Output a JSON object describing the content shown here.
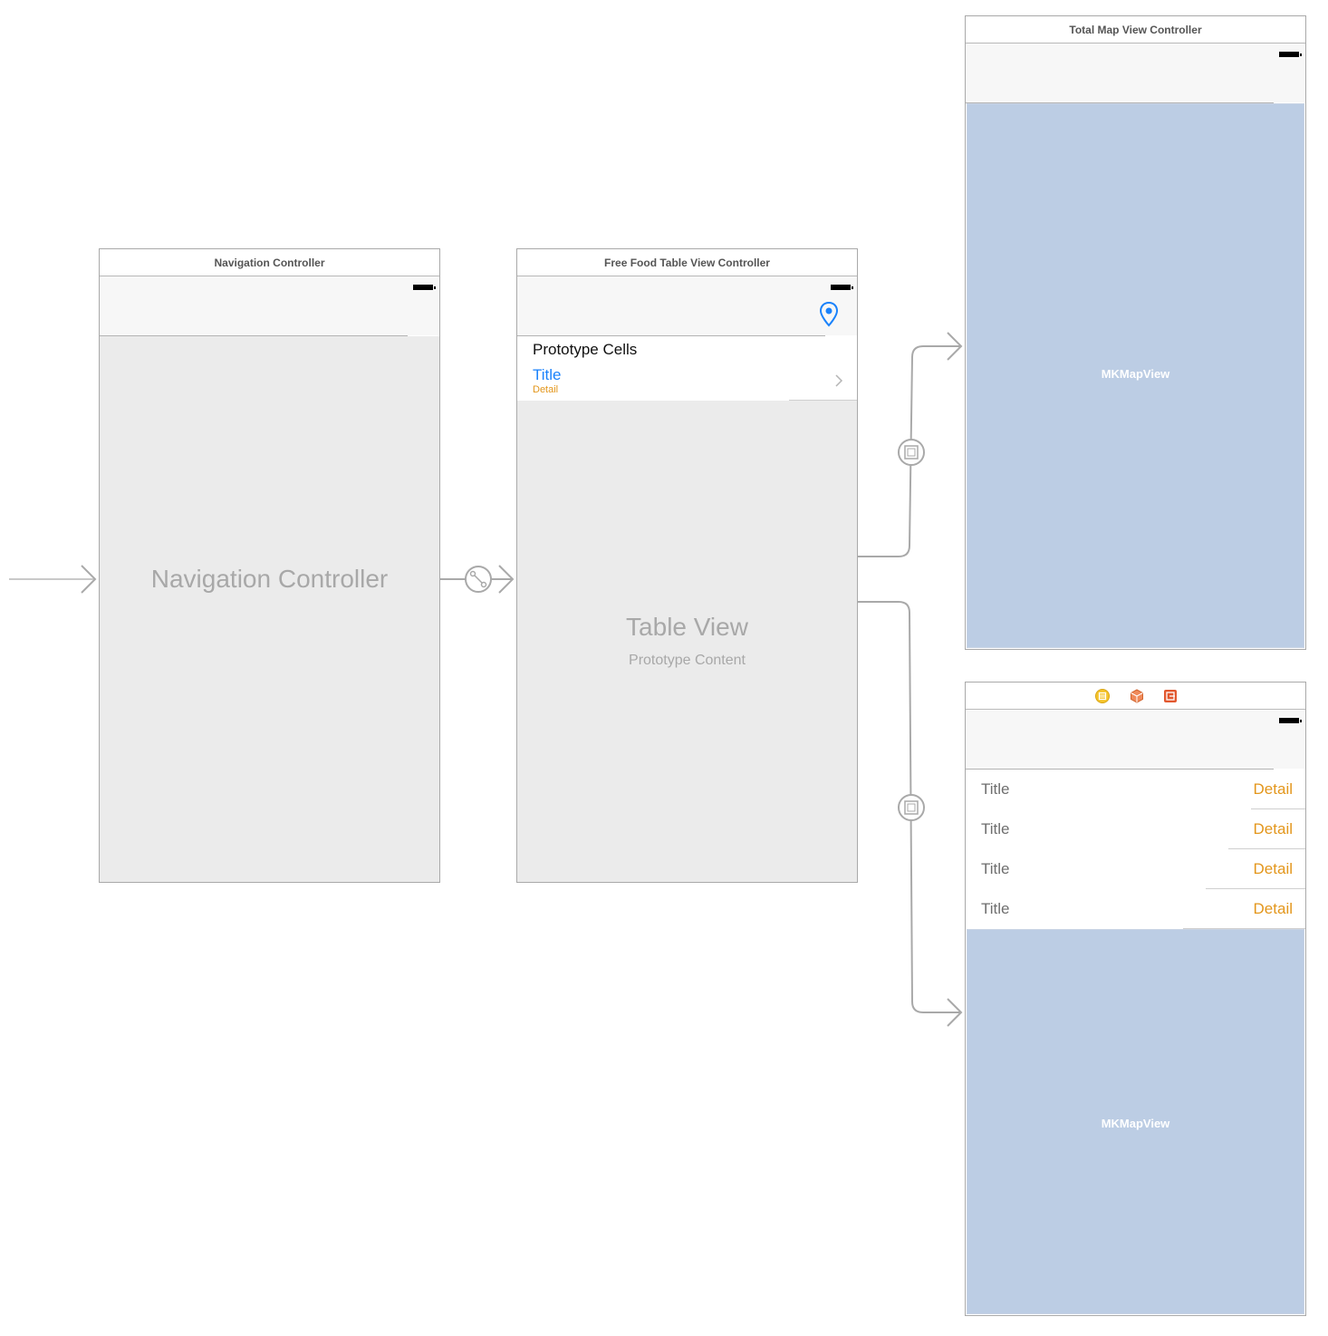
{
  "scenes": {
    "navigation": {
      "title": "Navigation Controller",
      "placeholder": "Navigation Controller"
    },
    "table": {
      "title": "Free Food Table View Controller",
      "prototype_header": "Prototype Cells",
      "cell_title": "Title",
      "cell_detail": "Detail",
      "placeholder": "Table View",
      "placeholder_sub": "Prototype Content",
      "nav_icon": "location-pin-icon"
    },
    "total_map": {
      "title": "Total Map View Controller",
      "map_label": "MKMapView"
    },
    "detail": {
      "dock_icons": [
        "view-controller-icon",
        "first-responder-icon",
        "exit-icon"
      ],
      "rows": [
        {
          "title": "Title",
          "detail": "Detail"
        },
        {
          "title": "Title",
          "detail": "Detail"
        },
        {
          "title": "Title",
          "detail": "Detail"
        },
        {
          "title": "Title",
          "detail": "Detail"
        }
      ],
      "map_label": "MKMapView"
    }
  },
  "colors": {
    "segue": "#a9a9a9",
    "map_fill": "#bccde4",
    "detail_text": "#e3961b",
    "tint_blue": "#1a82fb",
    "placeholder_gray": "#ebebeb"
  }
}
